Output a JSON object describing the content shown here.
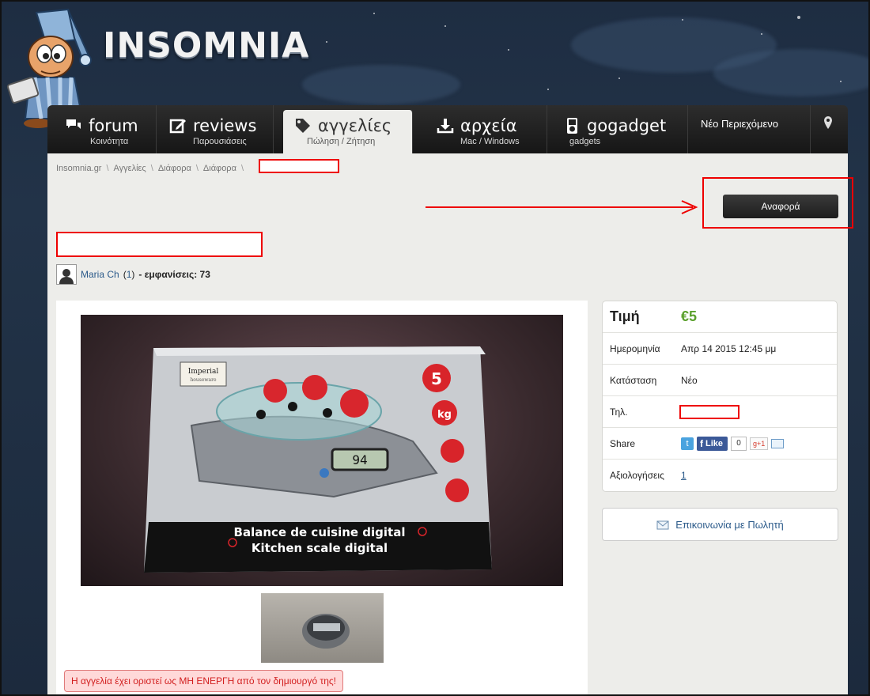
{
  "brand": {
    "logo_text": "INSOMNIA"
  },
  "nav": {
    "items": [
      {
        "label": "forum",
        "sub": "Κοινότητα",
        "icon": "chat-icon"
      },
      {
        "label": "reviews",
        "sub": "Παρουσιάσεις",
        "icon": "edit-icon"
      },
      {
        "label": "αγγελίες",
        "sub": "Πώληση / Ζήτηση",
        "icon": "tag-icon",
        "active": true
      },
      {
        "label": "αρχεία",
        "sub": "Mac / Windows",
        "icon": "download-icon"
      },
      {
        "label": "gogadget",
        "sub": "gadgets",
        "icon": "ipod-icon"
      }
    ],
    "new_content": "Νέο Περιεχόμενο",
    "location_icon": "map-pin-icon"
  },
  "breadcrumb": [
    "Insomnia.gr",
    "Αγγελίες",
    "Διάφορα",
    "Διάφορα"
  ],
  "report_button": "Αναφορά",
  "author": {
    "name": "Maria Ch",
    "count": "1",
    "views_text": "- εμφανίσεις: 73"
  },
  "photo": {
    "box_brand": "Imperial",
    "box_sub": "houseware",
    "weight_badge": "5",
    "weight_unit": "kg",
    "scale_display": "94",
    "caption_line1": "Balance de cuisine digital",
    "caption_line2": "Kitchen scale digital"
  },
  "notice": "Η αγγελία έχει οριστεί ως ΜΗ ΕΝΕΡΓΗ από τον δημιουργό της!",
  "details": {
    "price_label": "Τιμή",
    "price_value": "€5",
    "date_label": "Ημερομηνία",
    "date_value": "Απρ 14 2015 12:45 μμ",
    "condition_label": "Κατάσταση",
    "condition_value": "Νέο",
    "phone_label": "Τηλ.",
    "share_label": "Share",
    "share_like": "Like",
    "share_count": "0",
    "share_gplus": "g+1",
    "ratings_label": "Αξιολογήσεις",
    "ratings_value": "1"
  },
  "contact_button": "Επικοινωνία με Πωλητή",
  "colors": {
    "price": "#5aa02c",
    "link": "#2b5a8a",
    "annotation": "#ee0000"
  }
}
